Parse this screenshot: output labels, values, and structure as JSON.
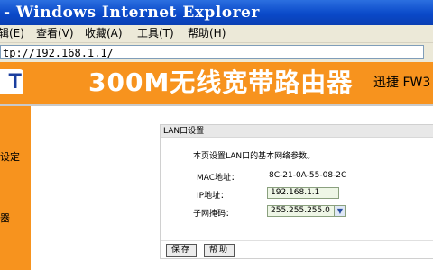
{
  "window": {
    "title": "- Windows Internet Explorer"
  },
  "menu": {
    "items": [
      "辑(E)",
      "查看(V)",
      "收藏(A)",
      "工具(T)",
      "帮助(H)"
    ]
  },
  "address": {
    "url": "tp://192.168.1.1/"
  },
  "header": {
    "logo_text": "T",
    "title": "300M无线宽带路由器",
    "brand": "迅捷 FW3"
  },
  "sidebar": {
    "items": [
      "设定",
      "器"
    ]
  },
  "lan": {
    "section_title": "LAN口设置",
    "description": "本页设置LAN口的基本网络参数。",
    "mac_label": "MAC地址：",
    "mac_value": "8C-21-0A-55-08-2C",
    "ip_label": "IP地址：",
    "ip_value": "192.168.1.1",
    "mask_label": "子网掩码：",
    "mask_value": "255.255.255.0",
    "save_label": "保存",
    "help_label": "帮助"
  }
}
